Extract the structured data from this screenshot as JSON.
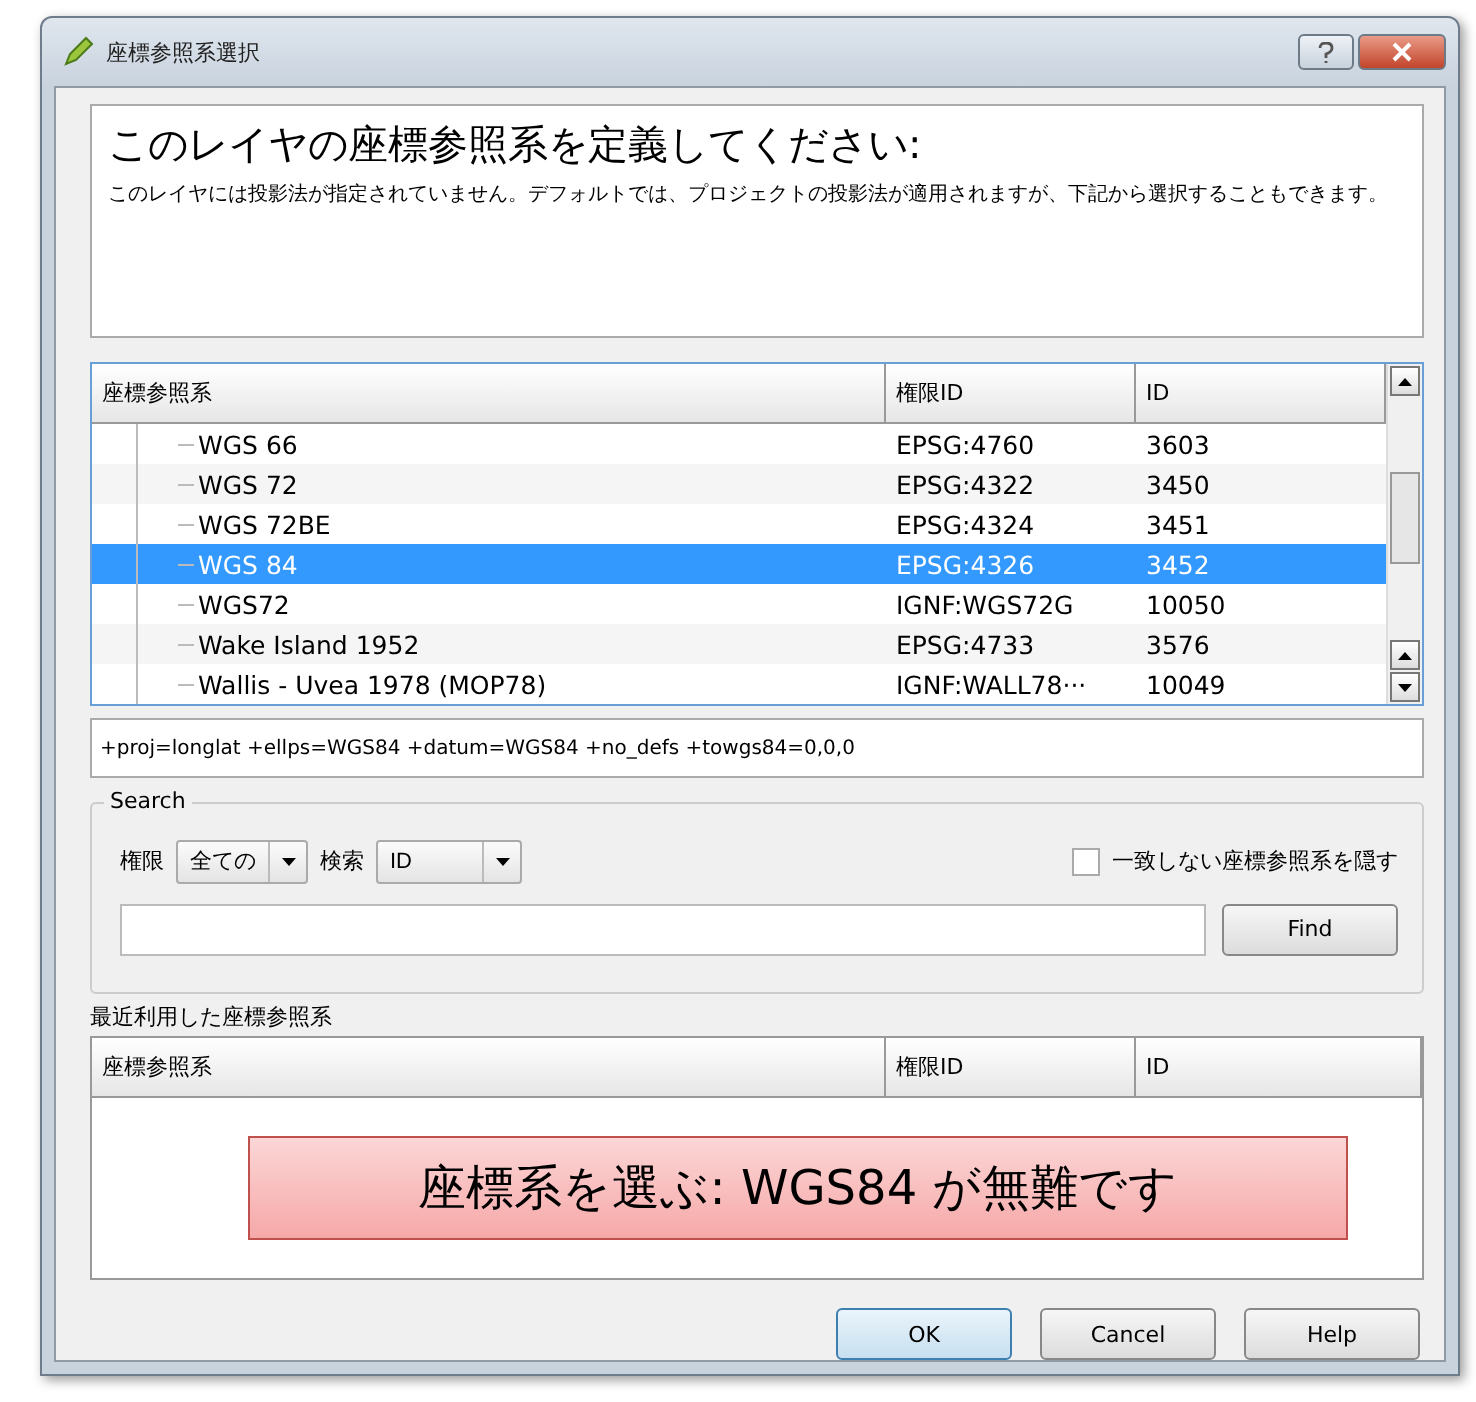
{
  "window": {
    "title": "座標参照系選択"
  },
  "header": {
    "heading": "このレイヤの座標参照系を定義してください:",
    "description": "このレイヤには投影法が指定されていません。デフォルトでは、プロジェクトの投影法が適用されますが、下記から選択することもできます。"
  },
  "crs_table": {
    "columns": [
      "座標参照系",
      "権限ID",
      "ID"
    ],
    "rows": [
      {
        "name": "WGS 66",
        "authority_id": "EPSG:4760",
        "id": "3603",
        "selected": false
      },
      {
        "name": "WGS 72",
        "authority_id": "EPSG:4322",
        "id": "3450",
        "selected": false
      },
      {
        "name": "WGS 72BE",
        "authority_id": "EPSG:4324",
        "id": "3451",
        "selected": false
      },
      {
        "name": "WGS 84",
        "authority_id": "EPSG:4326",
        "id": "3452",
        "selected": true
      },
      {
        "name": "WGS72",
        "authority_id": "IGNF:WGS72G",
        "id": "10050",
        "selected": false
      },
      {
        "name": "Wake Island 1952",
        "authority_id": "EPSG:4733",
        "id": "3576",
        "selected": false
      },
      {
        "name": "Wallis - Uvea 1978 (MOP78)",
        "authority_id": "IGNF:WALL78···",
        "id": "10049",
        "selected": false
      }
    ]
  },
  "proj_string": "+proj=longlat +ellps=WGS84 +datum=WGS84 +no_defs +towgs84=0,0,0",
  "search": {
    "title": "Search",
    "authority_label": "権限",
    "authority_value": "全ての",
    "search_label": "検索",
    "search_value": "ID",
    "hide_checkbox": {
      "label": "一致しない座標参照系を隠す",
      "checked": false
    },
    "find_button": "Find"
  },
  "recent": {
    "title": "最近利用した座標参照系",
    "columns": [
      "座標参照系",
      "権限ID",
      "ID"
    ]
  },
  "callout": "座標系を選ぶ: WGS84 が無難です",
  "buttons": [
    {
      "label": "OK",
      "default": true
    },
    {
      "label": "Cancel",
      "default": false
    },
    {
      "label": "Help",
      "default": false
    }
  ]
}
